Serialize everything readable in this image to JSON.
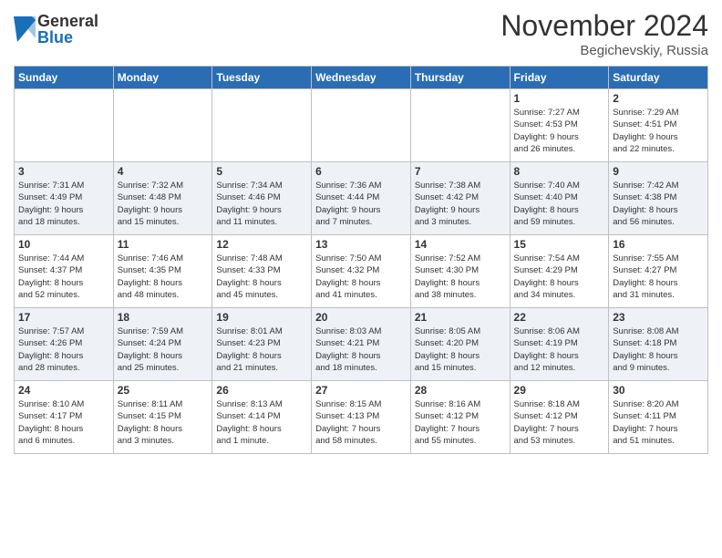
{
  "logo": {
    "general": "General",
    "blue": "Blue"
  },
  "title": "November 2024",
  "subtitle": "Begichevskiy, Russia",
  "weekdays": [
    "Sunday",
    "Monday",
    "Tuesday",
    "Wednesday",
    "Thursday",
    "Friday",
    "Saturday"
  ],
  "weeks": [
    [
      {
        "day": "",
        "info": ""
      },
      {
        "day": "",
        "info": ""
      },
      {
        "day": "",
        "info": ""
      },
      {
        "day": "",
        "info": ""
      },
      {
        "day": "",
        "info": ""
      },
      {
        "day": "1",
        "info": "Sunrise: 7:27 AM\nSunset: 4:53 PM\nDaylight: 9 hours\nand 26 minutes."
      },
      {
        "day": "2",
        "info": "Sunrise: 7:29 AM\nSunset: 4:51 PM\nDaylight: 9 hours\nand 22 minutes."
      }
    ],
    [
      {
        "day": "3",
        "info": "Sunrise: 7:31 AM\nSunset: 4:49 PM\nDaylight: 9 hours\nand 18 minutes."
      },
      {
        "day": "4",
        "info": "Sunrise: 7:32 AM\nSunset: 4:48 PM\nDaylight: 9 hours\nand 15 minutes."
      },
      {
        "day": "5",
        "info": "Sunrise: 7:34 AM\nSunset: 4:46 PM\nDaylight: 9 hours\nand 11 minutes."
      },
      {
        "day": "6",
        "info": "Sunrise: 7:36 AM\nSunset: 4:44 PM\nDaylight: 9 hours\nand 7 minutes."
      },
      {
        "day": "7",
        "info": "Sunrise: 7:38 AM\nSunset: 4:42 PM\nDaylight: 9 hours\nand 3 minutes."
      },
      {
        "day": "8",
        "info": "Sunrise: 7:40 AM\nSunset: 4:40 PM\nDaylight: 8 hours\nand 59 minutes."
      },
      {
        "day": "9",
        "info": "Sunrise: 7:42 AM\nSunset: 4:38 PM\nDaylight: 8 hours\nand 56 minutes."
      }
    ],
    [
      {
        "day": "10",
        "info": "Sunrise: 7:44 AM\nSunset: 4:37 PM\nDaylight: 8 hours\nand 52 minutes."
      },
      {
        "day": "11",
        "info": "Sunrise: 7:46 AM\nSunset: 4:35 PM\nDaylight: 8 hours\nand 48 minutes."
      },
      {
        "day": "12",
        "info": "Sunrise: 7:48 AM\nSunset: 4:33 PM\nDaylight: 8 hours\nand 45 minutes."
      },
      {
        "day": "13",
        "info": "Sunrise: 7:50 AM\nSunset: 4:32 PM\nDaylight: 8 hours\nand 41 minutes."
      },
      {
        "day": "14",
        "info": "Sunrise: 7:52 AM\nSunset: 4:30 PM\nDaylight: 8 hours\nand 38 minutes."
      },
      {
        "day": "15",
        "info": "Sunrise: 7:54 AM\nSunset: 4:29 PM\nDaylight: 8 hours\nand 34 minutes."
      },
      {
        "day": "16",
        "info": "Sunrise: 7:55 AM\nSunset: 4:27 PM\nDaylight: 8 hours\nand 31 minutes."
      }
    ],
    [
      {
        "day": "17",
        "info": "Sunrise: 7:57 AM\nSunset: 4:26 PM\nDaylight: 8 hours\nand 28 minutes."
      },
      {
        "day": "18",
        "info": "Sunrise: 7:59 AM\nSunset: 4:24 PM\nDaylight: 8 hours\nand 25 minutes."
      },
      {
        "day": "19",
        "info": "Sunrise: 8:01 AM\nSunset: 4:23 PM\nDaylight: 8 hours\nand 21 minutes."
      },
      {
        "day": "20",
        "info": "Sunrise: 8:03 AM\nSunset: 4:21 PM\nDaylight: 8 hours\nand 18 minutes."
      },
      {
        "day": "21",
        "info": "Sunrise: 8:05 AM\nSunset: 4:20 PM\nDaylight: 8 hours\nand 15 minutes."
      },
      {
        "day": "22",
        "info": "Sunrise: 8:06 AM\nSunset: 4:19 PM\nDaylight: 8 hours\nand 12 minutes."
      },
      {
        "day": "23",
        "info": "Sunrise: 8:08 AM\nSunset: 4:18 PM\nDaylight: 8 hours\nand 9 minutes."
      }
    ],
    [
      {
        "day": "24",
        "info": "Sunrise: 8:10 AM\nSunset: 4:17 PM\nDaylight: 8 hours\nand 6 minutes."
      },
      {
        "day": "25",
        "info": "Sunrise: 8:11 AM\nSunset: 4:15 PM\nDaylight: 8 hours\nand 3 minutes."
      },
      {
        "day": "26",
        "info": "Sunrise: 8:13 AM\nSunset: 4:14 PM\nDaylight: 8 hours\nand 1 minute."
      },
      {
        "day": "27",
        "info": "Sunrise: 8:15 AM\nSunset: 4:13 PM\nDaylight: 7 hours\nand 58 minutes."
      },
      {
        "day": "28",
        "info": "Sunrise: 8:16 AM\nSunset: 4:12 PM\nDaylight: 7 hours\nand 55 minutes."
      },
      {
        "day": "29",
        "info": "Sunrise: 8:18 AM\nSunset: 4:12 PM\nDaylight: 7 hours\nand 53 minutes."
      },
      {
        "day": "30",
        "info": "Sunrise: 8:20 AM\nSunset: 4:11 PM\nDaylight: 7 hours\nand 51 minutes."
      }
    ]
  ]
}
